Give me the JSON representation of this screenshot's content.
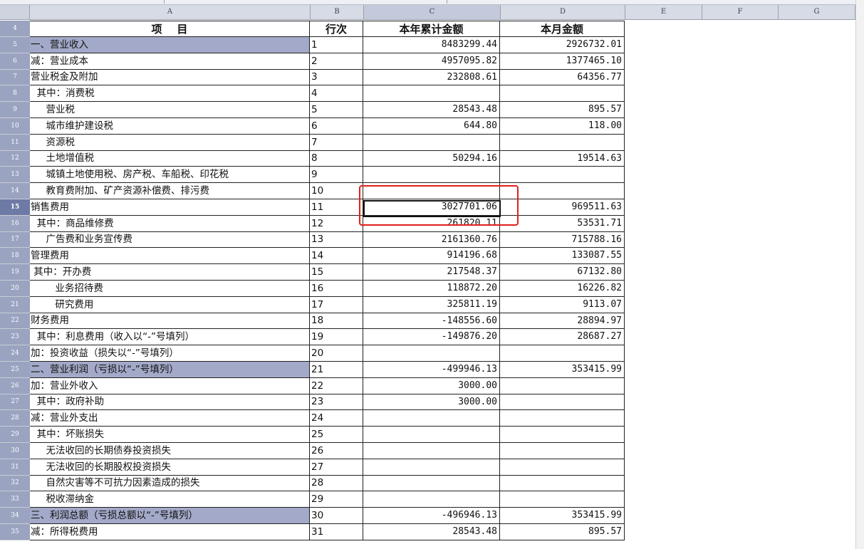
{
  "columns": [
    "A",
    "B",
    "C",
    "D",
    "E",
    "F",
    "G"
  ],
  "table_header": {
    "item": "项    目",
    "line_no": "行次",
    "ytd_amount": "本年累计金额",
    "month_amount": "本月金额",
    "row_num": "4"
  },
  "rows": [
    {
      "n": "5",
      "item": "一、营业收入",
      "line": "1",
      "ytd": "8483299.44",
      "month": "2926732.01",
      "shaded": true
    },
    {
      "n": "6",
      "item": "减：营业成本",
      "line": "2",
      "ytd": "4957095.82",
      "month": "1377465.10"
    },
    {
      "n": "7",
      "item": "营业税金及附加",
      "line": "3",
      "ytd": "232808.61",
      "month": "64356.77"
    },
    {
      "n": "8",
      "item": "  其中：消费税",
      "line": "4",
      "ytd": "",
      "month": ""
    },
    {
      "n": "9",
      "item": "     营业税",
      "line": "5",
      "ytd": "28543.48",
      "month": "895.57"
    },
    {
      "n": "10",
      "item": "     城市维护建设税",
      "line": "6",
      "ytd": "644.80",
      "month": "118.00"
    },
    {
      "n": "11",
      "item": "     资源税",
      "line": "7",
      "ytd": "",
      "month": ""
    },
    {
      "n": "12",
      "item": "     土地增值税",
      "line": "8",
      "ytd": "50294.16",
      "month": "19514.63"
    },
    {
      "n": "13",
      "item": "     城镇土地使用税、房产税、车船税、印花税",
      "line": "9",
      "ytd": "",
      "month": ""
    },
    {
      "n": "14",
      "item": "     教育费附加、矿产资源补偿费、排污费",
      "line": "10",
      "ytd": "",
      "month": ""
    },
    {
      "n": "15",
      "item": "销售费用",
      "line": "11",
      "ytd": "3027701.06",
      "month": "969511.63",
      "active": true
    },
    {
      "n": "16",
      "item": "  其中：商品维修费",
      "line": "12",
      "ytd": "261820.11",
      "month": "53531.71"
    },
    {
      "n": "17",
      "item": "     广告费和业务宣传费",
      "line": "13",
      "ytd": "2161360.76",
      "month": "715788.16"
    },
    {
      "n": "18",
      "item": "管理费用",
      "line": "14",
      "ytd": "914196.68",
      "month": "133087.55"
    },
    {
      "n": "19",
      "item": " 其中：开办费",
      "line": "15",
      "ytd": "217548.37",
      "month": "67132.80"
    },
    {
      "n": "20",
      "item": "        业务招待费",
      "line": "16",
      "ytd": "118872.20",
      "month": "16226.82"
    },
    {
      "n": "21",
      "item": "        研究费用",
      "line": "17",
      "ytd": "325811.19",
      "month": "9113.07"
    },
    {
      "n": "22",
      "item": "财务费用",
      "line": "18",
      "ytd": "-148556.60",
      "month": "28894.97"
    },
    {
      "n": "23",
      "item": "  其中：利息费用（收入以“-”号填列）",
      "line": "19",
      "ytd": "-149876.20",
      "month": "28687.27"
    },
    {
      "n": "24",
      "item": "加：投资收益（损失以“-”号填列）",
      "line": "20",
      "ytd": "",
      "month": ""
    },
    {
      "n": "25",
      "item": "二、营业利润（亏损以“-”号填列）",
      "line": "21",
      "ytd": "-499946.13",
      "month": "353415.99",
      "shaded": true
    },
    {
      "n": "26",
      "item": "加：营业外收入",
      "line": "22",
      "ytd": "3000.00",
      "month": ""
    },
    {
      "n": "27",
      "item": "  其中：政府补助",
      "line": "23",
      "ytd": "3000.00",
      "month": ""
    },
    {
      "n": "28",
      "item": "减：营业外支出",
      "line": "24",
      "ytd": "",
      "month": ""
    },
    {
      "n": "29",
      "item": "  其中：坏账损失",
      "line": "25",
      "ytd": "",
      "month": ""
    },
    {
      "n": "30",
      "item": "     无法收回的长期债券投资损失",
      "line": "26",
      "ytd": "",
      "month": ""
    },
    {
      "n": "31",
      "item": "     无法收回的长期股权投资损失",
      "line": "27",
      "ytd": "",
      "month": ""
    },
    {
      "n": "32",
      "item": "     自然灾害等不可抗力因素造成的损失",
      "line": "28",
      "ytd": "",
      "month": ""
    },
    {
      "n": "33",
      "item": "     税收滞纳金",
      "line": "29",
      "ytd": "",
      "month": ""
    },
    {
      "n": "34",
      "item": "三、利润总额（亏损总额以“-”号填列）",
      "line": "30",
      "ytd": "-496946.13",
      "month": "353415.99",
      "shaded": true
    },
    {
      "n": "35",
      "item": "减：所得税费用",
      "line": "31",
      "ytd": "28543.48",
      "month": "895.57"
    }
  ]
}
